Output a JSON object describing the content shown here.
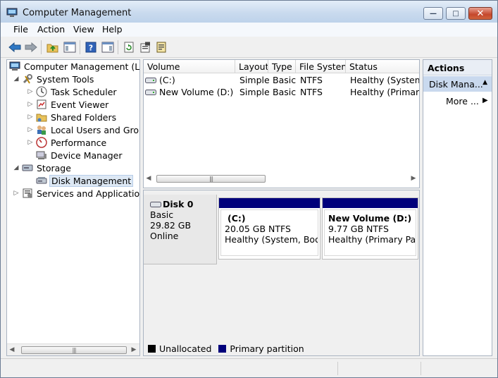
{
  "window": {
    "title": "Computer Management",
    "controls": {
      "minimize": "—",
      "maximize": "□",
      "close": "✕"
    }
  },
  "menu": [
    "File",
    "Action",
    "View",
    "Help"
  ],
  "toolbar": {
    "icons": [
      "back-arrow-icon",
      "forward-arrow-icon",
      "up-folder-icon",
      "show-hide-tree-icon",
      "help-icon",
      "show-hide-action-pane-icon",
      "refresh-icon",
      "properties-icon",
      "export-list-icon"
    ]
  },
  "tree": {
    "items": [
      {
        "label": "Computer Management (Local",
        "expander": "",
        "icon": "computer-management-icon"
      },
      {
        "label": "System Tools",
        "expander": "◢",
        "icon": "tools-icon"
      },
      {
        "label": "Task Scheduler",
        "expander": "▷",
        "icon": "clock-icon"
      },
      {
        "label": "Event Viewer",
        "expander": "▷",
        "icon": "event-viewer-icon"
      },
      {
        "label": "Shared Folders",
        "expander": "▷",
        "icon": "shared-folder-icon"
      },
      {
        "label": "Local Users and Groups",
        "expander": "▷",
        "icon": "users-icon"
      },
      {
        "label": "Performance",
        "expander": "▷",
        "icon": "performance-icon"
      },
      {
        "label": "Device Manager",
        "expander": "",
        "icon": "device-manager-icon"
      },
      {
        "label": "Storage",
        "expander": "◢",
        "icon": "storage-icon"
      },
      {
        "label": "Disk Management",
        "expander": "",
        "icon": "disk-management-icon",
        "selected": true
      },
      {
        "label": "Services and Applications",
        "expander": "▷",
        "icon": "services-icon"
      }
    ]
  },
  "volume_list": {
    "columns": [
      "Volume",
      "Layout",
      "Type",
      "File System",
      "Status"
    ],
    "rows": [
      {
        "volume": "(C:)",
        "layout": "Simple",
        "type": "Basic",
        "fs": "NTFS",
        "status": "Healthy (System, B"
      },
      {
        "volume": "New Volume (D:)",
        "layout": "Simple",
        "type": "Basic",
        "fs": "NTFS",
        "status": "Healthy (Primary P"
      }
    ]
  },
  "disk": {
    "name": "Disk 0",
    "type": "Basic",
    "size": "29.82 GB",
    "state": "Online",
    "partitions": [
      {
        "name": "(C:)",
        "size": "20.05 GB NTFS",
        "status": "Healthy (System, Boot, A"
      },
      {
        "name": "New Volume  (D:)",
        "size": "9.77 GB NTFS",
        "status": "Healthy (Primary Partiti"
      }
    ]
  },
  "legend": [
    {
      "label": "Unallocated",
      "color": "#000000"
    },
    {
      "label": "Primary partition",
      "color": "#00007b"
    }
  ],
  "actions": {
    "header": "Actions",
    "section": "Disk Mana...",
    "more": "More ..."
  },
  "scroll": {
    "thumb": "|||"
  },
  "colors": {
    "primary_partition": "#00007b",
    "selection": "#dde8f4",
    "action_section": "#c9d9ee"
  }
}
